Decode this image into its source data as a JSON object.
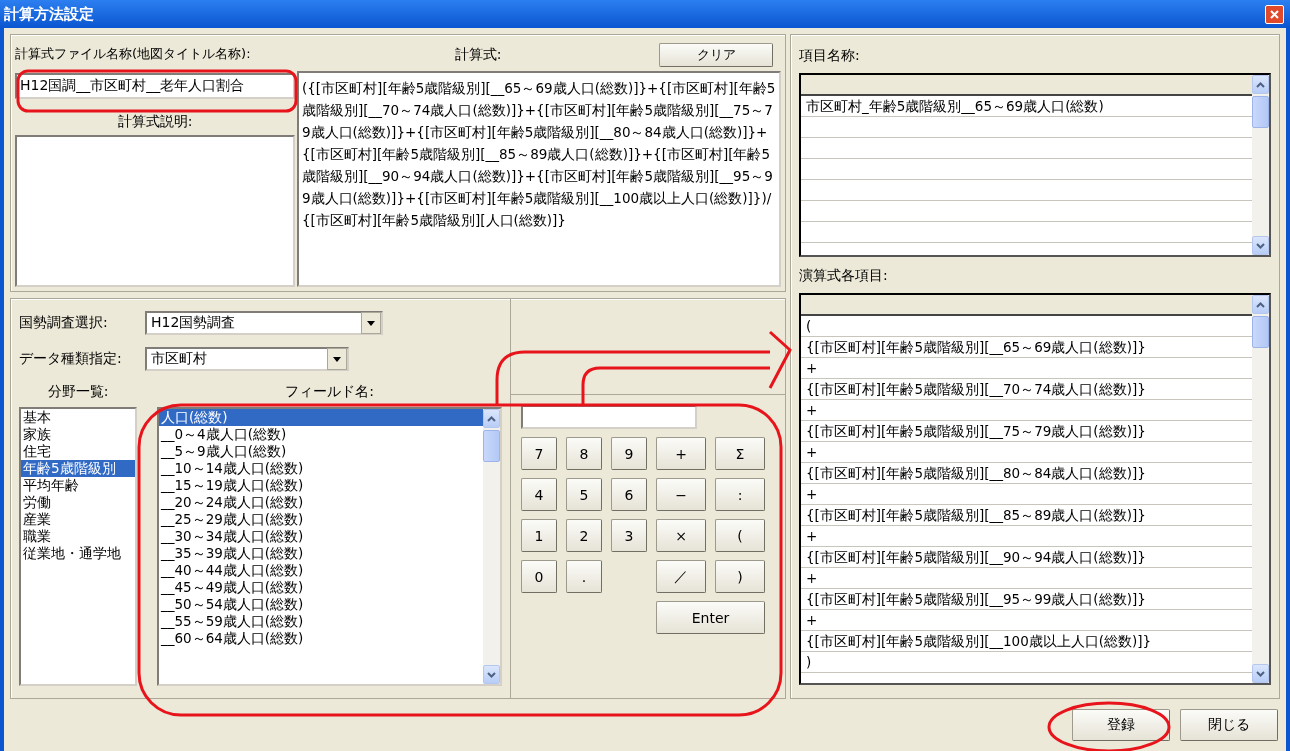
{
  "window": {
    "title": "計算方法設定"
  },
  "file_name": {
    "label": "計算式ファイル名称(地図タイトル名称):",
    "value": "H12国調__市区町村__老年人口割合"
  },
  "description": {
    "label": "計算式説明:"
  },
  "formula": {
    "label": "計算式:",
    "clear_button": "クリア",
    "value": "({[市区町村][年齢5歳階級別][__65～69歳人口(総数)]}+{[市区町村][年齢5歳階級別][__70～74歳人口(総数)]}+{[市区町村][年齢5歳階級別][__75～79歳人口(総数)]}+{[市区町村][年齢5歳階級別][__80～84歳人口(総数)]}+{[市区町村][年齢5歳階級別][__85～89歳人口(総数)]}+{[市区町村][年齢5歳階級別][__90～94歳人口(総数)]}+{[市区町村][年齢5歳階級別][__95～99歳人口(総数)]}+{[市区町村][年齢5歳階級別][__100歳以上人口(総数)]})/{[市区町村][年齢5歳階級別][人口(総数)]}"
  },
  "census": {
    "label": "国勢調査選択:",
    "value": "H12国勢調査"
  },
  "data_type": {
    "label": "データ種類指定:",
    "value": "市区町村"
  },
  "categories": {
    "label": "分野一覧:",
    "items": [
      {
        "label": "基本",
        "selected": false
      },
      {
        "label": "家族",
        "selected": false
      },
      {
        "label": "住宅",
        "selected": false
      },
      {
        "label": "年齢5歳階級別",
        "selected": true
      },
      {
        "label": "平均年齢",
        "selected": false
      },
      {
        "label": "労働",
        "selected": false
      },
      {
        "label": "産業",
        "selected": false
      },
      {
        "label": "職業",
        "selected": false
      },
      {
        "label": "従業地・通学地",
        "selected": false
      }
    ]
  },
  "fields": {
    "label": "フィールド名:",
    "items": [
      {
        "label": "人口(総数)",
        "selected": true
      },
      {
        "label": "__0～4歳人口(総数)",
        "selected": false
      },
      {
        "label": "__5～9歳人口(総数)",
        "selected": false
      },
      {
        "label": "__10～14歳人口(総数)",
        "selected": false
      },
      {
        "label": "__15～19歳人口(総数)",
        "selected": false
      },
      {
        "label": "__20～24歳人口(総数)",
        "selected": false
      },
      {
        "label": "__25～29歳人口(総数)",
        "selected": false
      },
      {
        "label": "__30～34歳人口(総数)",
        "selected": false
      },
      {
        "label": "__35～39歳人口(総数)",
        "selected": false
      },
      {
        "label": "__40～44歳人口(総数)",
        "selected": false
      },
      {
        "label": "__45～49歳人口(総数)",
        "selected": false
      },
      {
        "label": "__50～54歳人口(総数)",
        "selected": false
      },
      {
        "label": "__55～59歳人口(総数)",
        "selected": false
      },
      {
        "label": "__60～64歳人口(総数)",
        "selected": false
      }
    ]
  },
  "keypad": {
    "rows": [
      {
        "digits": [
          "7",
          "8",
          "9"
        ],
        "operators": [
          "+",
          "Σ"
        ]
      },
      {
        "digits": [
          "4",
          "5",
          "6"
        ],
        "operators": [
          "−",
          ":"
        ]
      },
      {
        "digits": [
          "1",
          "2",
          "3"
        ],
        "operators": [
          "×",
          "("
        ]
      },
      {
        "digits": [
          "0",
          "."
        ],
        "operators": [
          "／",
          ")"
        ]
      }
    ],
    "enter": "Enter"
  },
  "item_names": {
    "label": "項目名称:",
    "items": [
      "市区町村_年齢5歳階級別__65～69歳人口(総数)"
    ]
  },
  "expression_items": {
    "label": "演算式各項目:",
    "items": [
      "(",
      "{[市区町村][年齢5歳階級別][__65～69歳人口(総数)]}",
      "+",
      "{[市区町村][年齢5歳階級別][__70～74歳人口(総数)]}",
      "+",
      "{[市区町村][年齢5歳階級別][__75～79歳人口(総数)]}",
      "+",
      "{[市区町村][年齢5歳階級別][__80～84歳人口(総数)]}",
      "+",
      "{[市区町村][年齢5歳階級別][__85～89歳人口(総数)]}",
      "+",
      "{[市区町村][年齢5歳階級別][__90～94歳人口(総数)]}",
      "+",
      "{[市区町村][年齢5歳階級別][__95～99歳人口(総数)]}",
      "+",
      "{[市区町村][年齢5歳階級別][__100歳以上人口(総数)]}",
      ")"
    ]
  },
  "buttons": [
    {
      "label": "登録"
    },
    {
      "label": "閉じる"
    }
  ]
}
